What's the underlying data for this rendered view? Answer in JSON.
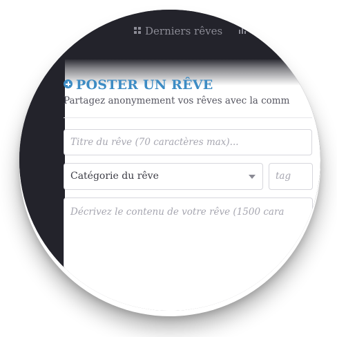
{
  "nav": {
    "latest_label": "Derniers rêves",
    "latest_icon": "grid-icon",
    "next_icon": "bars-icon"
  },
  "form": {
    "title": "POSTER UN RÊVE",
    "title_icon": "plus-circle-icon",
    "subtitle": "Partagez anonymement vos rêves avec la comm",
    "title_placeholder": "Titre du rêve (70 caractères max)...",
    "category_value": "Catégorie du rêve",
    "tags_placeholder": "tag",
    "description_placeholder": "Décrivez le contenu de votre rêve (1500 cara"
  },
  "colors": {
    "accent": "#3d8cc4",
    "dark_background": "#23232b",
    "nav_text": "#8c8c96"
  }
}
